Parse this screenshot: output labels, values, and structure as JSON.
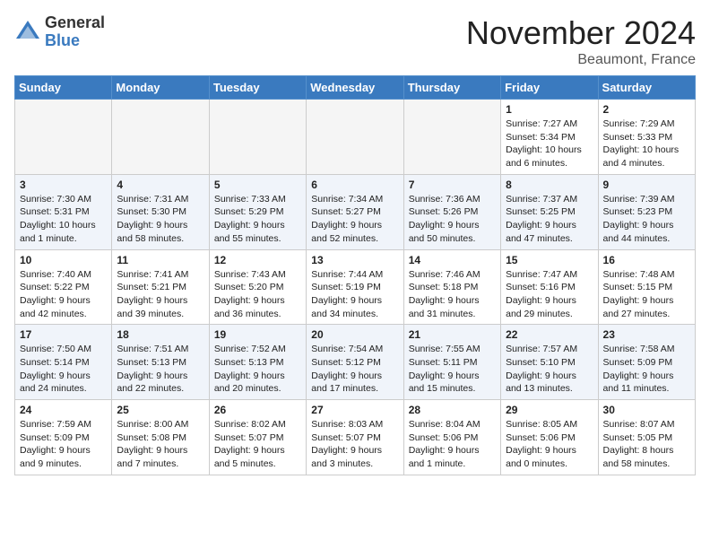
{
  "header": {
    "logo_general": "General",
    "logo_blue": "Blue",
    "title": "November 2024",
    "location": "Beaumont, France"
  },
  "days_of_week": [
    "Sunday",
    "Monday",
    "Tuesday",
    "Wednesday",
    "Thursday",
    "Friday",
    "Saturday"
  ],
  "weeks": [
    [
      {
        "day": "",
        "info": ""
      },
      {
        "day": "",
        "info": ""
      },
      {
        "day": "",
        "info": ""
      },
      {
        "day": "",
        "info": ""
      },
      {
        "day": "",
        "info": ""
      },
      {
        "day": "1",
        "info": "Sunrise: 7:27 AM\nSunset: 5:34 PM\nDaylight: 10 hours and 6 minutes."
      },
      {
        "day": "2",
        "info": "Sunrise: 7:29 AM\nSunset: 5:33 PM\nDaylight: 10 hours and 4 minutes."
      }
    ],
    [
      {
        "day": "3",
        "info": "Sunrise: 7:30 AM\nSunset: 5:31 PM\nDaylight: 10 hours and 1 minute."
      },
      {
        "day": "4",
        "info": "Sunrise: 7:31 AM\nSunset: 5:30 PM\nDaylight: 9 hours and 58 minutes."
      },
      {
        "day": "5",
        "info": "Sunrise: 7:33 AM\nSunset: 5:29 PM\nDaylight: 9 hours and 55 minutes."
      },
      {
        "day": "6",
        "info": "Sunrise: 7:34 AM\nSunset: 5:27 PM\nDaylight: 9 hours and 52 minutes."
      },
      {
        "day": "7",
        "info": "Sunrise: 7:36 AM\nSunset: 5:26 PM\nDaylight: 9 hours and 50 minutes."
      },
      {
        "day": "8",
        "info": "Sunrise: 7:37 AM\nSunset: 5:25 PM\nDaylight: 9 hours and 47 minutes."
      },
      {
        "day": "9",
        "info": "Sunrise: 7:39 AM\nSunset: 5:23 PM\nDaylight: 9 hours and 44 minutes."
      }
    ],
    [
      {
        "day": "10",
        "info": "Sunrise: 7:40 AM\nSunset: 5:22 PM\nDaylight: 9 hours and 42 minutes."
      },
      {
        "day": "11",
        "info": "Sunrise: 7:41 AM\nSunset: 5:21 PM\nDaylight: 9 hours and 39 minutes."
      },
      {
        "day": "12",
        "info": "Sunrise: 7:43 AM\nSunset: 5:20 PM\nDaylight: 9 hours and 36 minutes."
      },
      {
        "day": "13",
        "info": "Sunrise: 7:44 AM\nSunset: 5:19 PM\nDaylight: 9 hours and 34 minutes."
      },
      {
        "day": "14",
        "info": "Sunrise: 7:46 AM\nSunset: 5:18 PM\nDaylight: 9 hours and 31 minutes."
      },
      {
        "day": "15",
        "info": "Sunrise: 7:47 AM\nSunset: 5:16 PM\nDaylight: 9 hours and 29 minutes."
      },
      {
        "day": "16",
        "info": "Sunrise: 7:48 AM\nSunset: 5:15 PM\nDaylight: 9 hours and 27 minutes."
      }
    ],
    [
      {
        "day": "17",
        "info": "Sunrise: 7:50 AM\nSunset: 5:14 PM\nDaylight: 9 hours and 24 minutes."
      },
      {
        "day": "18",
        "info": "Sunrise: 7:51 AM\nSunset: 5:13 PM\nDaylight: 9 hours and 22 minutes."
      },
      {
        "day": "19",
        "info": "Sunrise: 7:52 AM\nSunset: 5:13 PM\nDaylight: 9 hours and 20 minutes."
      },
      {
        "day": "20",
        "info": "Sunrise: 7:54 AM\nSunset: 5:12 PM\nDaylight: 9 hours and 17 minutes."
      },
      {
        "day": "21",
        "info": "Sunrise: 7:55 AM\nSunset: 5:11 PM\nDaylight: 9 hours and 15 minutes."
      },
      {
        "day": "22",
        "info": "Sunrise: 7:57 AM\nSunset: 5:10 PM\nDaylight: 9 hours and 13 minutes."
      },
      {
        "day": "23",
        "info": "Sunrise: 7:58 AM\nSunset: 5:09 PM\nDaylight: 9 hours and 11 minutes."
      }
    ],
    [
      {
        "day": "24",
        "info": "Sunrise: 7:59 AM\nSunset: 5:09 PM\nDaylight: 9 hours and 9 minutes."
      },
      {
        "day": "25",
        "info": "Sunrise: 8:00 AM\nSunset: 5:08 PM\nDaylight: 9 hours and 7 minutes."
      },
      {
        "day": "26",
        "info": "Sunrise: 8:02 AM\nSunset: 5:07 PM\nDaylight: 9 hours and 5 minutes."
      },
      {
        "day": "27",
        "info": "Sunrise: 8:03 AM\nSunset: 5:07 PM\nDaylight: 9 hours and 3 minutes."
      },
      {
        "day": "28",
        "info": "Sunrise: 8:04 AM\nSunset: 5:06 PM\nDaylight: 9 hours and 1 minute."
      },
      {
        "day": "29",
        "info": "Sunrise: 8:05 AM\nSunset: 5:06 PM\nDaylight: 9 hours and 0 minutes."
      },
      {
        "day": "30",
        "info": "Sunrise: 8:07 AM\nSunset: 5:05 PM\nDaylight: 8 hours and 58 minutes."
      }
    ]
  ],
  "colors": {
    "header_bg": "#3a7abf",
    "alt_row_bg": "#eef2f8"
  }
}
